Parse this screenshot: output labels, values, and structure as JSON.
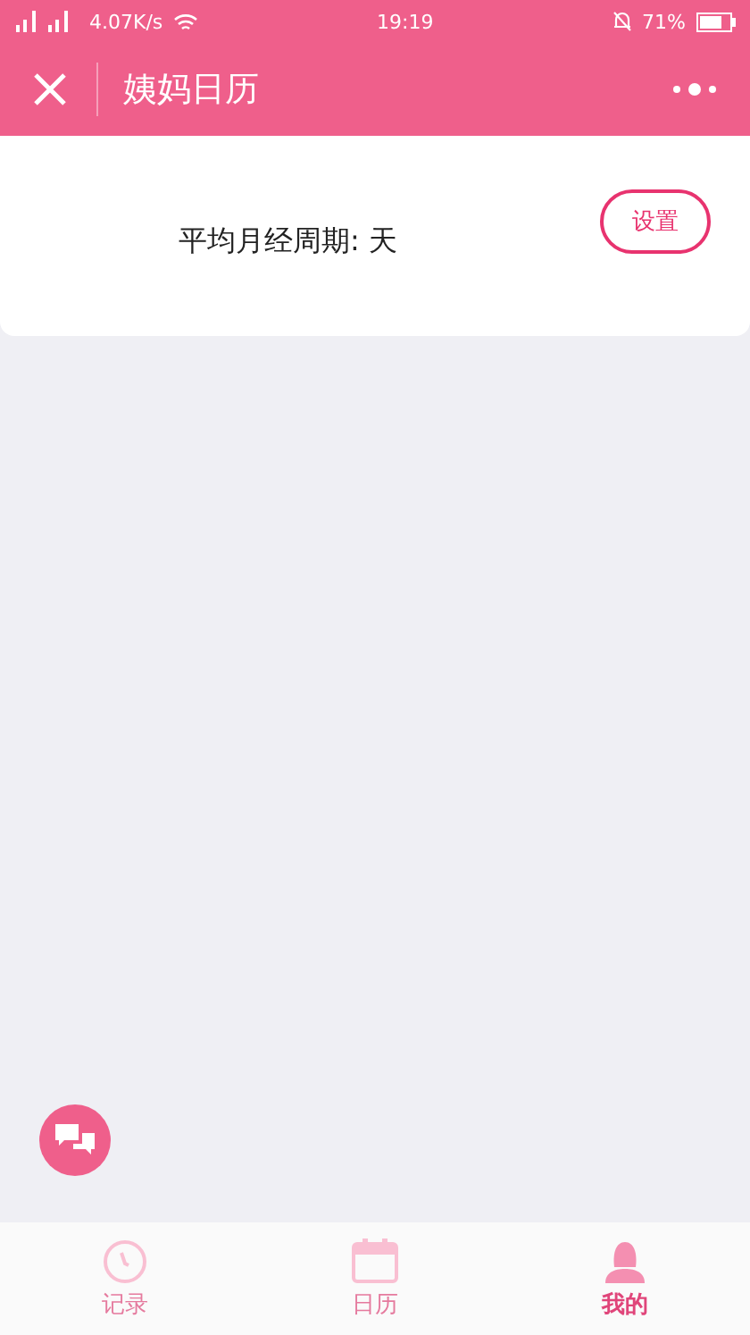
{
  "status_bar": {
    "speed": "4.07K/s",
    "time": "19:19",
    "battery": "71%"
  },
  "header": {
    "title": "姨妈日历"
  },
  "card": {
    "text": "平均月经周期: 天",
    "button": "设置"
  },
  "tabs": [
    {
      "kind": "clock",
      "label": "记录",
      "selected": false
    },
    {
      "kind": "calendar",
      "label": "日历",
      "selected": false
    },
    {
      "kind": "person",
      "label": "我的",
      "selected": true
    }
  ]
}
